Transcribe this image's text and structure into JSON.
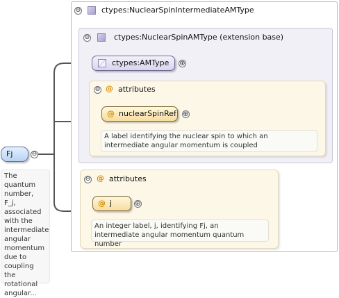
{
  "root_element": {
    "name": "Fj",
    "documentation": "The quantum number, F_j, associated with the intermediate angular momentum due to coupling the rotational angular..."
  },
  "complex_type": {
    "name": "ctypes:NuclearSpinIntermediateAMType"
  },
  "base_type": {
    "name": "ctypes:NuclearSpinAMType (extension base)",
    "inherited_type": "ctypes:AMType",
    "attributes_label": "attributes",
    "attribute": {
      "name": "nuclearSpinRef",
      "documentation": "A label identifying the nuclear spin to which an intermediate angular momentum is coupled"
    }
  },
  "own_attributes": {
    "label": "attributes",
    "attribute": {
      "name": "j",
      "documentation": "An integer label, j, identifying Fj, an intermediate angular momentum quantum number"
    }
  },
  "symbols": {
    "collapse": "⊖",
    "expand": "⊕",
    "attribute_marker": "@"
  },
  "colors": {
    "connector": "#555555",
    "attribute_marker": "#d78c00",
    "type_fill": "#d9d5ee",
    "attribute_fill": "#fdf7e8",
    "element_fill": "#cfe2f8"
  }
}
